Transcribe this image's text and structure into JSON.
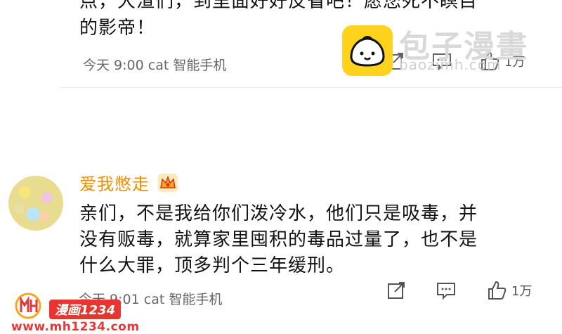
{
  "comment1": {
    "text_line1": "点，大渣们，到里面好好反省吧！愿您死不瞑目",
    "text_line2": "的影帝！",
    "time": "今天 9:00",
    "device": "cat 智能手机",
    "like_count": "1万"
  },
  "comment2": {
    "username": "爱我憋走",
    "text_line1": "亲们，不是我给你们泼冷水，他们只是吸毒，并",
    "text_line2": "没有贩毒，就算家里囤积的毒品过量了，也不是",
    "text_line3": "什么大罪，顶多判个三年缓刑。",
    "time": "今天 9:01",
    "device": "cat 智能手机",
    "like_count": "1万"
  },
  "watermark": {
    "brand": "包子漫畫",
    "url": "baozimh.com"
  },
  "mh_logo": {
    "tag": "漫画1234",
    "url": "www.mh1234.com"
  },
  "icons": [
    "share-icon",
    "comment-icon",
    "like-icon",
    "crown-badge-icon",
    "bun-logo-icon"
  ],
  "colors": {
    "username": "#f08c00",
    "meta": "#666666",
    "watermark": "#d9d9d9",
    "logo_yellow": "#ffd21e",
    "mh_red": "#e03a3a"
  }
}
